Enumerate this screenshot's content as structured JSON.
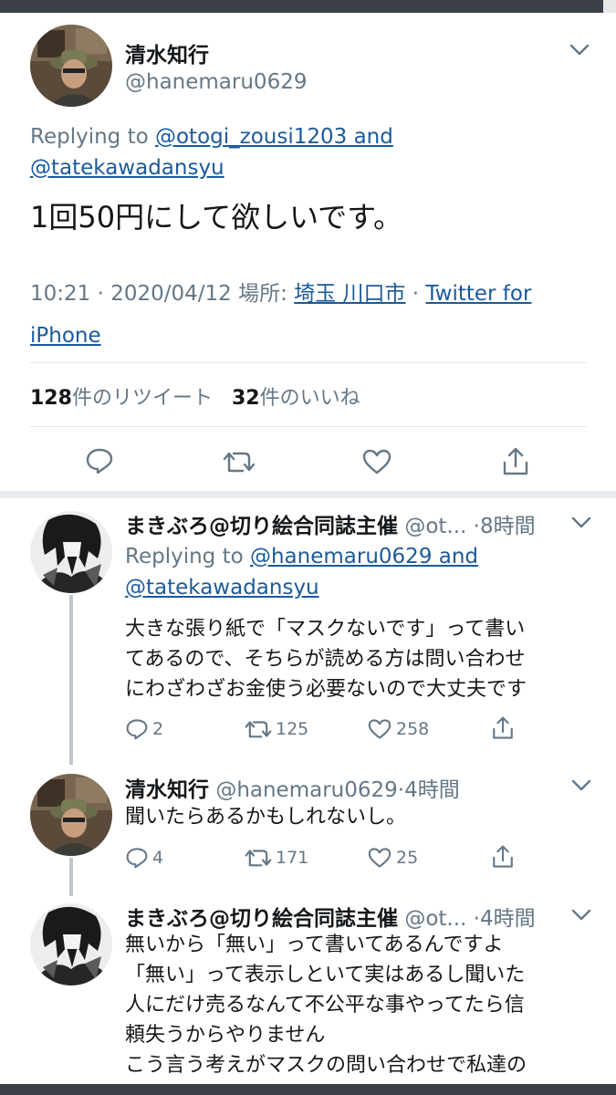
{
  "main_tweet": {
    "name": "清水知行",
    "handle": "@hanemaru0629",
    "replying_prefix": "Replying to ",
    "replying_users": "@otogi_zousi1203 and",
    "replying_users_2": "@tatekawadansyu",
    "text": "1回50円にして欲しいです。",
    "meta_time": "10:21 · 2020/04/12 場所: ",
    "meta_place": "埼玉 川口市",
    "meta_sep": " · ",
    "meta_source_1": "Twitter for",
    "meta_source_2": "iPhone",
    "retweet_count": "128",
    "retweet_label": "件のリツイート",
    "like_count": "32",
    "like_label": "件のいいね"
  },
  "replies": [
    {
      "name": "まきぶろ@切り絵合同誌主催",
      "handle": "@ot...",
      "time": "·8時間",
      "replying_prefix": "Replying to ",
      "replying_users": "@hanemaru0629 and",
      "replying_users_2": "@tatekawadansyu",
      "lines": [
        "大きな張り紙で「マスクないです」って書い",
        "てあるので、そちらが読める方は問い合わせ",
        "にわざわざお金使う必要ないので大丈夫です"
      ],
      "reply_count": "2",
      "retweet_count": "125",
      "like_count": "258"
    },
    {
      "name": "清水知行",
      "handle": "@hanemaru0629",
      "time": "·4時間",
      "lines": [
        "聞いたらあるかもしれないし。"
      ],
      "reply_count": "4",
      "retweet_count": "171",
      "like_count": "25"
    },
    {
      "name": "まきぶろ@切り絵合同誌主催",
      "handle": "@ot...",
      "time": "·4時間",
      "lines": [
        "無いから「無い」って書いてあるんですよ",
        "「無い」って表示しといて実はあるし聞いた",
        "人にだけ売るなんて不公平な事やってたら信",
        "頼失うからやりません",
        "こう言う考えがマスクの問い合わせで私達の"
      ]
    }
  ],
  "icons": [
    "chevron-down-icon",
    "reply-icon",
    "retweet-icon",
    "like-icon",
    "share-icon"
  ],
  "colors": {
    "link": "#1b5a9a",
    "muted": "#657786",
    "divider": "#e1e8ed"
  }
}
